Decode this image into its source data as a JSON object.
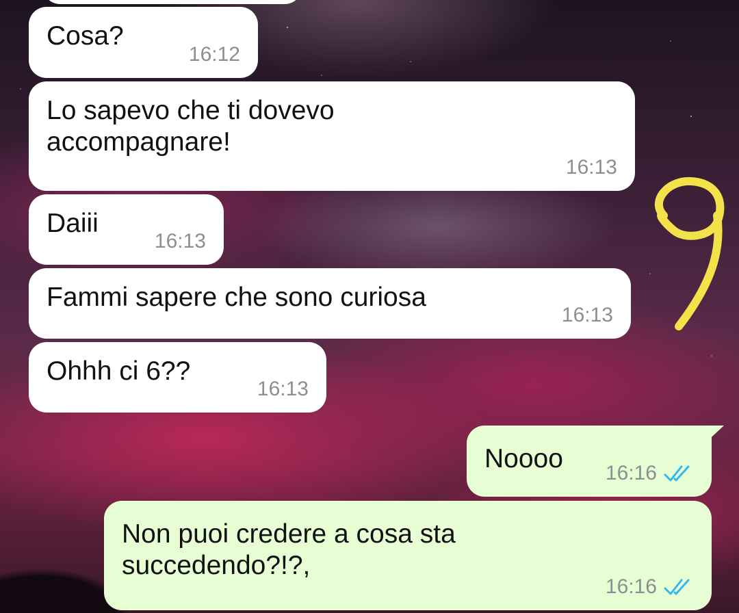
{
  "colors": {
    "incoming_bubble": "#ffffff",
    "outgoing_bubble": "#e7fdd3",
    "timestamp": "#8a8f93",
    "read_ticks": "#34b7f1",
    "doodle": "#f3e24a"
  },
  "messages": [
    {
      "direction": "incoming",
      "text": "Cosa?",
      "time": "16:12"
    },
    {
      "direction": "incoming",
      "text": "Lo sapevo che ti dovevo\naccompagnare!",
      "time": "16:13"
    },
    {
      "direction": "incoming",
      "text": "Daiii",
      "time": "16:13"
    },
    {
      "direction": "incoming",
      "text": "Fammi sapere che sono curiosa",
      "time": "16:13"
    },
    {
      "direction": "incoming",
      "text": "Ohhh ci 6??",
      "time": "16:13"
    },
    {
      "direction": "outgoing",
      "text": "Noooo",
      "time": "16:16",
      "status": "read-double-check-icon"
    },
    {
      "direction": "outgoing",
      "text": "Non puoi credere a cosa sta\nsuccedendo?!?,",
      "time": "16:16",
      "status": "read-double-check-icon"
    }
  ],
  "overlay": {
    "doodle_icon": "hand-drawn-nine-icon"
  }
}
